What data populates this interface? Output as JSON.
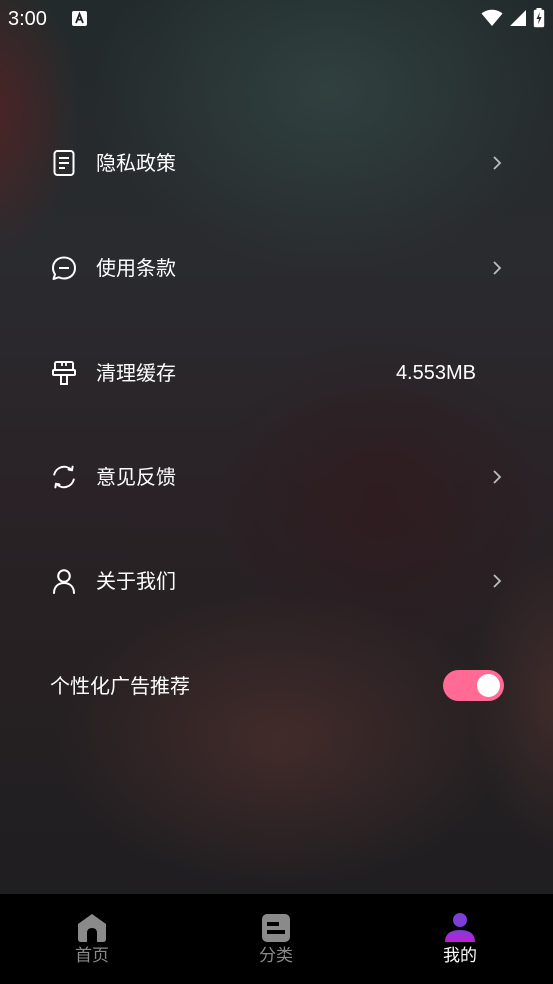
{
  "status_bar": {
    "time": "3:00",
    "notification_icon": "a-letter-icon",
    "icons": [
      "wifi-icon",
      "signal-icon",
      "battery-charging-icon"
    ]
  },
  "menu": {
    "items": [
      {
        "label": "隐私政策",
        "icon": "document-icon",
        "chevron": true
      },
      {
        "label": "使用条款",
        "icon": "chat-bubble-icon",
        "chevron": true
      },
      {
        "label": "清理缓存",
        "icon": "brush-icon",
        "value": "4.553MB",
        "chevron": false
      },
      {
        "label": "意见反馈",
        "icon": "refresh-icon",
        "chevron": true
      },
      {
        "label": "关于我们",
        "icon": "person-icon",
        "chevron": true
      }
    ]
  },
  "ad_setting": {
    "label": "个性化广告推荐",
    "enabled": true,
    "toggle_color": "#ff6b95"
  },
  "bottom_nav": {
    "items": [
      {
        "label": "首页",
        "icon": "home-icon",
        "active": false
      },
      {
        "label": "分类",
        "icon": "category-icon",
        "active": false
      },
      {
        "label": "我的",
        "icon": "profile-icon",
        "active": true
      }
    ],
    "active_color_top": "#7b3fd6",
    "active_color_bottom": "#c21bd6"
  }
}
